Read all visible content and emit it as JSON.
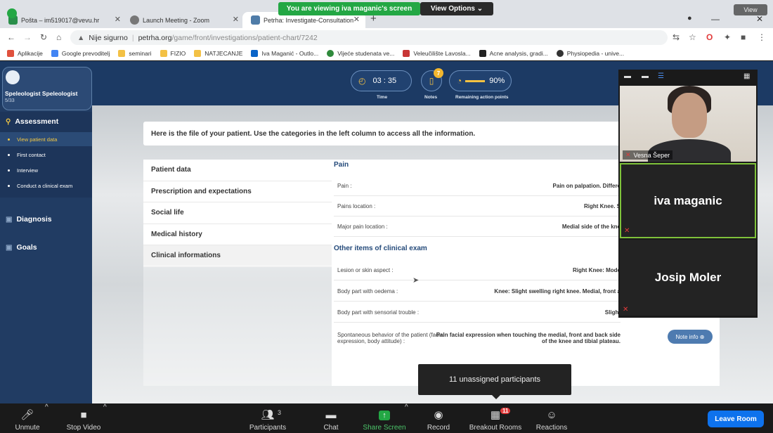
{
  "zoom_banner": {
    "sharing_text": "You are viewing iva maganic's screen",
    "view_options_label": "View Options ⌄",
    "view_label": "View"
  },
  "browser": {
    "tabs": [
      {
        "title": "Pošta – im519017@vevu.hr",
        "active": false
      },
      {
        "title": "Launch Meeting - Zoom",
        "active": false
      },
      {
        "title": "Petrha: Investigate-Consultation",
        "active": true
      }
    ],
    "address": {
      "security": "Nije sigurno",
      "host": "petrha.org",
      "path": "/game/front/investigations/patient-chart/7242"
    },
    "bookmarks": [
      "Aplikacije",
      "Google prevoditelj",
      "seminari",
      "FIZIO",
      "NATJECANJE",
      "Iva Maganić - Outlo...",
      "Vijeće studenata ve...",
      "Veleučilište Lavosla...",
      "Acne analysis, gradi...",
      "Physiopedia - unive..."
    ]
  },
  "app": {
    "user": {
      "name": "Speleologist Speleologist",
      "score": "5/33"
    },
    "hud": {
      "time_value": "03 : 35",
      "time_label": "Time",
      "notes_badge": "7",
      "notes_label": "Notes",
      "points_value": "90%",
      "points_label": "Remaining action points"
    },
    "menu": {
      "assessment": "Assessment",
      "assessment_items": [
        "View patient data",
        "First contact",
        "Interview",
        "Conduct a clinical exam"
      ],
      "diagnosis": "Diagnosis",
      "goals": "Goals"
    },
    "banner_text": "Here is the file of your patient. Use the categories in the left column to access all the information.",
    "categories": [
      "Patient data",
      "Prescription and expectations",
      "Social life",
      "Medical history",
      "Clinical informations"
    ],
    "sections": {
      "pain_title": "Pain",
      "pain_rows": [
        {
          "key": "Pain :",
          "value": "Pain on palpation. Differe"
        },
        {
          "key": "Pains location :",
          "value": "Right Knee. S"
        },
        {
          "key": "Major pain location :",
          "value": "Medial side of the kne"
        }
      ],
      "other_title": "Other items of clinical exam",
      "other_rows": [
        {
          "key": "Lesion or skin aspect :",
          "value": "Right Knee: Mode"
        },
        {
          "key": "Body part with oedema :",
          "value": "Knee: Slight swelling right knee. Medial, front a"
        },
        {
          "key": "Body part with sensorial trouble :",
          "value": "Slight"
        },
        {
          "key": "Spontaneous behavior of the patient (facial expression, body attitude) :",
          "value": "Pain facial expression when touching the medial, front and back side of the knee and tibial plateau."
        }
      ],
      "note_button": "Note info ⊕"
    }
  },
  "zoom": {
    "participants": [
      {
        "name": "Vesna Šeper",
        "muted": true
      },
      {
        "name": "iva maganic",
        "muted": true
      },
      {
        "name": "Josip Moler",
        "muted": true
      }
    ],
    "tooltip": "11 unassigned participants",
    "toolbar": {
      "unmute": "Unmute",
      "stop_video": "Stop Video",
      "participants": "Participants",
      "participants_count": "3",
      "chat": "Chat",
      "share_screen": "Share Screen",
      "record": "Record",
      "breakout": "Breakout Rooms",
      "breakout_badge": "11",
      "reactions": "Reactions",
      "leave": "Leave Room"
    }
  }
}
